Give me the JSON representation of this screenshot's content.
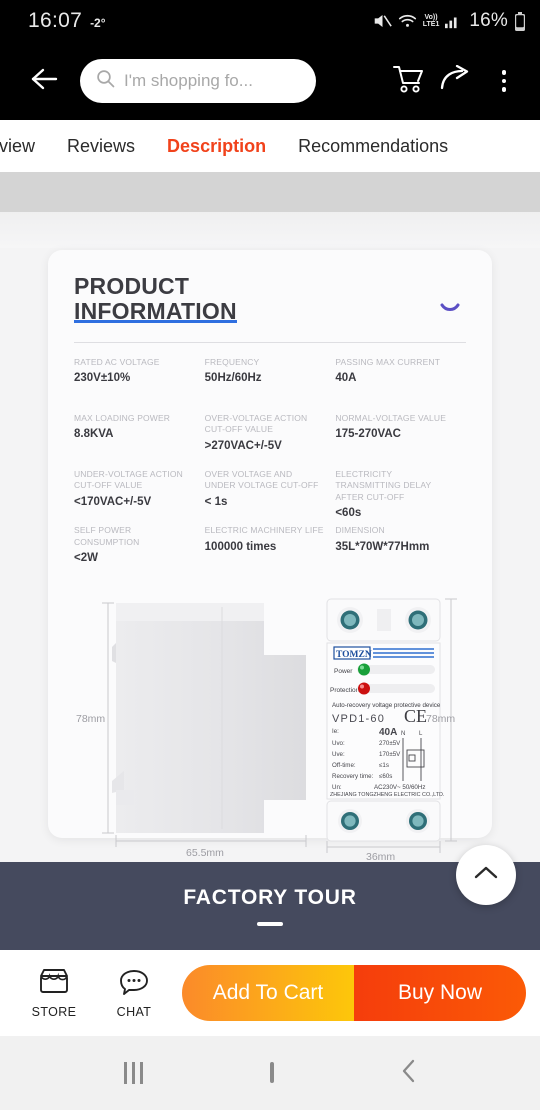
{
  "status_bar": {
    "time": "16:07",
    "temperature": "-2°",
    "network_label_top": "Vo))",
    "network_label_bottom": "LTE1",
    "battery_percent": "16%",
    "icons": [
      "mute-icon",
      "wifi-icon",
      "volte-icon",
      "signal-icon",
      "battery-icon"
    ]
  },
  "app_bar": {
    "back_icon": "back-arrow-icon",
    "search_placeholder": "I'm shopping fo...",
    "search_icon": "search-icon",
    "cart_icon": "cart-icon",
    "share_icon": "share-icon",
    "overflow_icon": "more-vertical-icon"
  },
  "tabs": {
    "items": [
      {
        "label": "verview",
        "active": false
      },
      {
        "label": "Reviews",
        "active": false
      },
      {
        "label": "Description",
        "active": true
      },
      {
        "label": "Recommendations",
        "active": false
      }
    ],
    "active_color": "#f1421b"
  },
  "card": {
    "title_line1": "PRODUCT",
    "title_line2": "INFORMATION",
    "underline_color": "#2f6fe0",
    "collapse_icon": "chevron-down-icon",
    "specs": [
      {
        "label": "RATED AC VOLTAGE",
        "value": "230V±10%"
      },
      {
        "label": "FREQUENCY",
        "value": "50Hz/60Hz"
      },
      {
        "label": "PASSING MAX CURRENT",
        "value": "40A"
      },
      {
        "label": "MAX LOADING POWER",
        "value": "8.8KVA"
      },
      {
        "label": "OVER-VOLTAGE ACTION CUT-OFF VALUE",
        "value": ">270VAC+/-5V"
      },
      {
        "label": "NORMAL-VOLTAGE VALUE",
        "value": "175-270VAC"
      },
      {
        "label": "UNDER-VOLTAGE ACTION CUT-OFF VALUE",
        "value": "<170VAC+/-5V"
      },
      {
        "label": "OVER VOLTAGE AND UNDER VOLTAGE CUT-OFF",
        "value": "< 1s"
      },
      {
        "label": "ELECTRICITY TRANSMITTING DELAY AFTER CUT-OFF",
        "value": "<60s"
      },
      {
        "label": "SELF POWER CONSUMPTION",
        "value": "<2W"
      },
      {
        "label": "ELECTRIC MACHINERY LIFE",
        "value": "100000 times"
      },
      {
        "label": "DIMENSION",
        "value": "35L*70W*77Hmm"
      }
    ],
    "diagram": {
      "side_view": {
        "height_label": "78mm",
        "width_label": "65.5mm"
      },
      "front_view": {
        "height_label": "78mm",
        "width_label": "36mm",
        "brand": "TOMZN",
        "led_power_label": "Power",
        "led_protection_label": "Protection",
        "led_power_color": "#19a03a",
        "led_protection_color": "#cc1111",
        "description": "Auto-recovery voltage protective device",
        "model": "VPD1-60",
        "cert": "CE",
        "terminal_n": "N",
        "terminal_l": "L",
        "rows": [
          {
            "key": "Ie:",
            "value": "40A"
          },
          {
            "key": "Uvo:",
            "value": "270±5V"
          },
          {
            "key": "Uve:",
            "value": "170±5V"
          },
          {
            "key": "Off-time:",
            "value": "≤1s"
          },
          {
            "key": "Recovery time:",
            "value": "≤60s"
          },
          {
            "key": "Un:",
            "value": "AC230V~ 50/60Hz"
          }
        ],
        "manufacturer": "ZHEJIANG TONGZHENG ELECTRIC CO.,LTD."
      }
    }
  },
  "factory_section": {
    "title": "FACTORY TOUR",
    "background": "#454a5e",
    "scroll_top_icon": "chevron-up-icon"
  },
  "action_bar": {
    "store_label": "STORE",
    "store_icon": "store-icon",
    "chat_label": "CHAT",
    "chat_icon": "chat-bubble-icon",
    "add_to_cart_label": "Add To Cart",
    "buy_now_label": "Buy Now",
    "cart_color": "#fb8a2a",
    "buy_color": "#f53d0c"
  },
  "nav_bar": {
    "recents_icon": "recents-icon",
    "home_icon": "home-icon",
    "back_icon": "back-chevron-icon"
  }
}
